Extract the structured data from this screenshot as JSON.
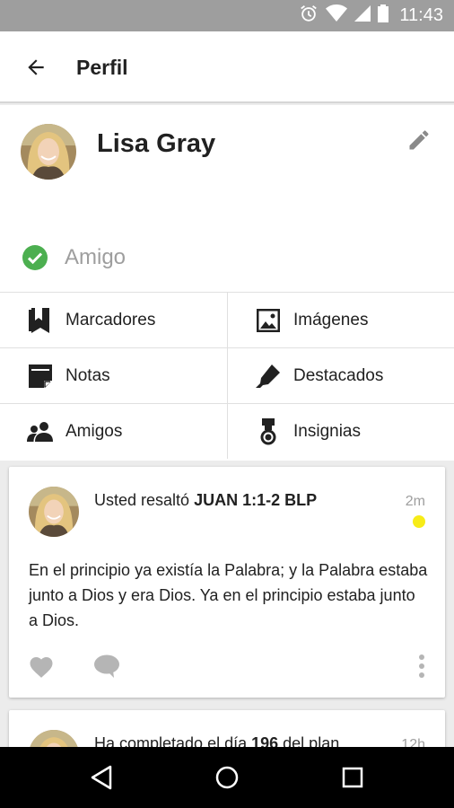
{
  "status_bar": {
    "time": "11:43",
    "icons": [
      "alarm-icon",
      "wifi-icon",
      "signal-icon",
      "battery-icon"
    ]
  },
  "app_bar": {
    "title": "Perfil",
    "back_icon": "arrow-back-icon"
  },
  "profile": {
    "name": "Lisa Gray",
    "edit_icon": "pencil-icon",
    "friend_status": {
      "icon": "check-circle-icon",
      "label": "Amigo",
      "color": "#4caf50"
    }
  },
  "menu": [
    {
      "label": "Marcadores",
      "icon": "bookmark-icon"
    },
    {
      "label": "Imágenes",
      "icon": "image-icon"
    },
    {
      "label": "Notas",
      "icon": "note-icon"
    },
    {
      "label": "Destacados",
      "icon": "highlighter-icon"
    },
    {
      "label": "Amigos",
      "icon": "people-icon"
    },
    {
      "label": "Insignias",
      "icon": "badge-medal-icon"
    }
  ],
  "feed": [
    {
      "headline_prefix": "Usted resaltó ",
      "headline_bold": "JUAN 1:1-2 BLP",
      "time": "2m",
      "highlight_color": "#f7ec18",
      "body": "En el principio ya existía la Palabra; y la Palabra estaba junto a Dios y era Dios.  Ya en el principio estaba junto a Dios.",
      "actions": [
        "heart-icon",
        "comment-icon",
        "more-vert-icon"
      ]
    },
    {
      "headline_prefix": "Ha completado el día ",
      "headline_bold": "196",
      "headline_suffix": " del plan",
      "time": "12h"
    }
  ],
  "nav_bar": {
    "icons": [
      "nav-back-icon",
      "nav-home-icon",
      "nav-recents-icon"
    ]
  },
  "colors": {
    "status_bar": "#9e9e9e",
    "accent_green": "#4caf50",
    "highlight_yellow": "#f7ec18",
    "action_gray": "#b5b5b5"
  }
}
